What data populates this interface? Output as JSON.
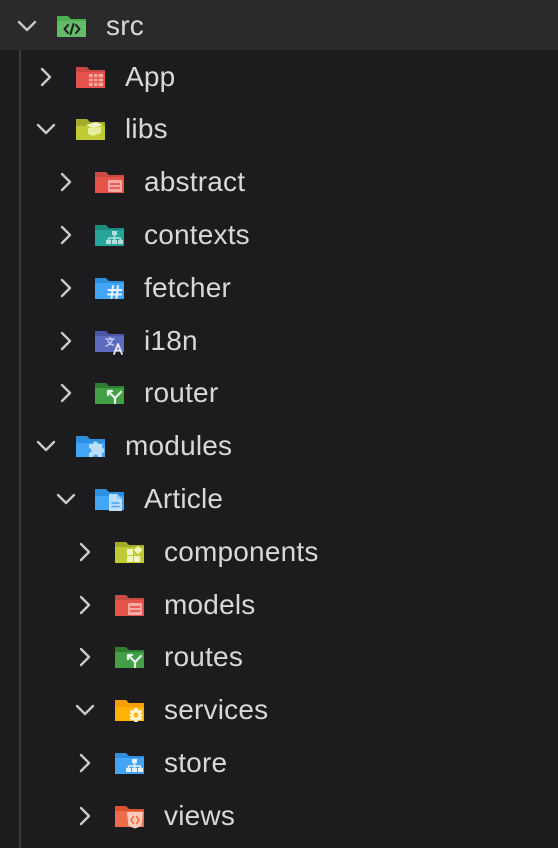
{
  "tree": {
    "root": {
      "label": "src",
      "state": "expanded",
      "icon": "source-folder-icon",
      "color": "#4caf50"
    },
    "items": [
      {
        "label": "App",
        "state": "collapsed",
        "depth": 1,
        "icon": "app-folder-icon",
        "color": "#e5534b"
      },
      {
        "label": "libs",
        "state": "expanded",
        "depth": 1,
        "icon": "library-folder-icon",
        "color": "#c0ca33"
      },
      {
        "label": "abstract",
        "state": "collapsed",
        "depth": 2,
        "icon": "abstract-folder-icon",
        "color": "#e5534b"
      },
      {
        "label": "contexts",
        "state": "collapsed",
        "depth": 2,
        "icon": "hierarchy-folder-icon",
        "color": "#26a69a"
      },
      {
        "label": "fetcher",
        "state": "collapsed",
        "depth": 2,
        "icon": "hash-folder-icon",
        "color": "#42a5f5"
      },
      {
        "label": "i18n",
        "state": "collapsed",
        "depth": 2,
        "icon": "translate-folder-icon",
        "color": "#5c6bc0"
      },
      {
        "label": "router",
        "state": "collapsed",
        "depth": 2,
        "icon": "route-folder-icon",
        "color": "#43a047"
      },
      {
        "label": "modules",
        "state": "expanded",
        "depth": 1,
        "icon": "puzzle-folder-icon",
        "color": "#42a5f5"
      },
      {
        "label": "Article",
        "state": "expanded",
        "depth": 2,
        "icon": "document-folder-icon",
        "color": "#42a5f5"
      },
      {
        "label": "components",
        "state": "collapsed",
        "depth": 3,
        "icon": "components-folder-icon",
        "color": "#c0ca33"
      },
      {
        "label": "models",
        "state": "collapsed",
        "depth": 3,
        "icon": "models-folder-icon",
        "color": "#e5534b"
      },
      {
        "label": "routes",
        "state": "collapsed",
        "depth": 3,
        "icon": "route-folder-icon",
        "color": "#43a047"
      },
      {
        "label": "services",
        "state": "expanded",
        "depth": 3,
        "icon": "gear-folder-icon",
        "color": "#ffb300"
      },
      {
        "label": "store",
        "state": "collapsed",
        "depth": 3,
        "icon": "hierarchy-folder-icon",
        "color": "#42a5f5"
      },
      {
        "label": "views",
        "state": "collapsed",
        "depth": 3,
        "icon": "html-folder-icon",
        "color": "#ef6c4a"
      }
    ]
  }
}
